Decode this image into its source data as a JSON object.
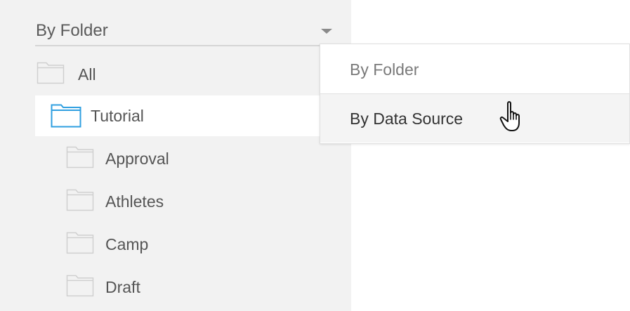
{
  "folder_view_select": {
    "value": "By Folder",
    "caret_icon": "triangle-down-icon"
  },
  "tree": {
    "all": {
      "label": "All",
      "icon": "folder-icon"
    },
    "tutorial": {
      "label": "Tutorial",
      "icon": "folder-icon",
      "selected": true,
      "accent": "#2f9fe0"
    },
    "children": [
      {
        "label": "Approval",
        "icon": "folder-icon"
      },
      {
        "label": "Athletes",
        "icon": "folder-icon"
      },
      {
        "label": "Camp",
        "icon": "folder-icon"
      },
      {
        "label": "Draft",
        "icon": "folder-icon"
      }
    ]
  },
  "dropdown": {
    "options": [
      {
        "label": "By Folder",
        "color": "#7a7a7a"
      },
      {
        "label": "By Data Source",
        "color": "#333333",
        "hovered": true
      }
    ]
  },
  "cursor": {
    "icon": "hand-pointer-icon"
  }
}
